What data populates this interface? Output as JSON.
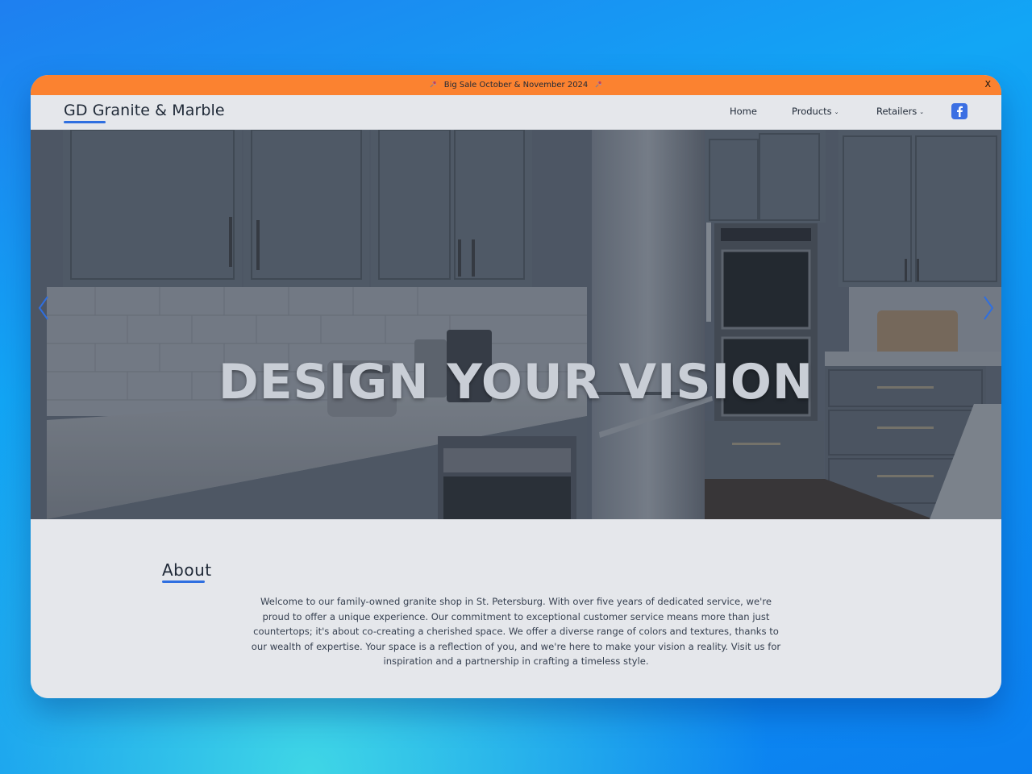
{
  "banner": {
    "text": "Big Sale October & November 2024",
    "pin_icon": "pushpin-icon",
    "close_label": "X",
    "color": "#fb8230"
  },
  "nav": {
    "brand": "GD Granite & Marble",
    "accent": "#2f6fe0",
    "items": [
      {
        "label": "Home",
        "has_dropdown": false
      },
      {
        "label": "Products",
        "has_dropdown": true
      },
      {
        "label": "Retailers",
        "has_dropdown": true
      }
    ],
    "social_icon": "facebook-icon"
  },
  "hero": {
    "title": "DESIGN YOUR VISION",
    "image": "kitchen-photo",
    "prev_icon": "chevron-left-icon",
    "next_icon": "chevron-right-icon"
  },
  "about": {
    "heading": "About",
    "body": "Welcome to our family-owned granite shop in St. Petersburg. With over five years of dedicated service, we're proud to offer a unique experience. Our commitment to exceptional customer service means more than just countertops; it's about co-creating a cherished space. We offer a diverse range of colors and textures, thanks to our wealth of expertise. Your space is a reflection of you, and we're here to make your vision a reality. Visit us for inspiration and a partnership in crafting a timeless style."
  }
}
